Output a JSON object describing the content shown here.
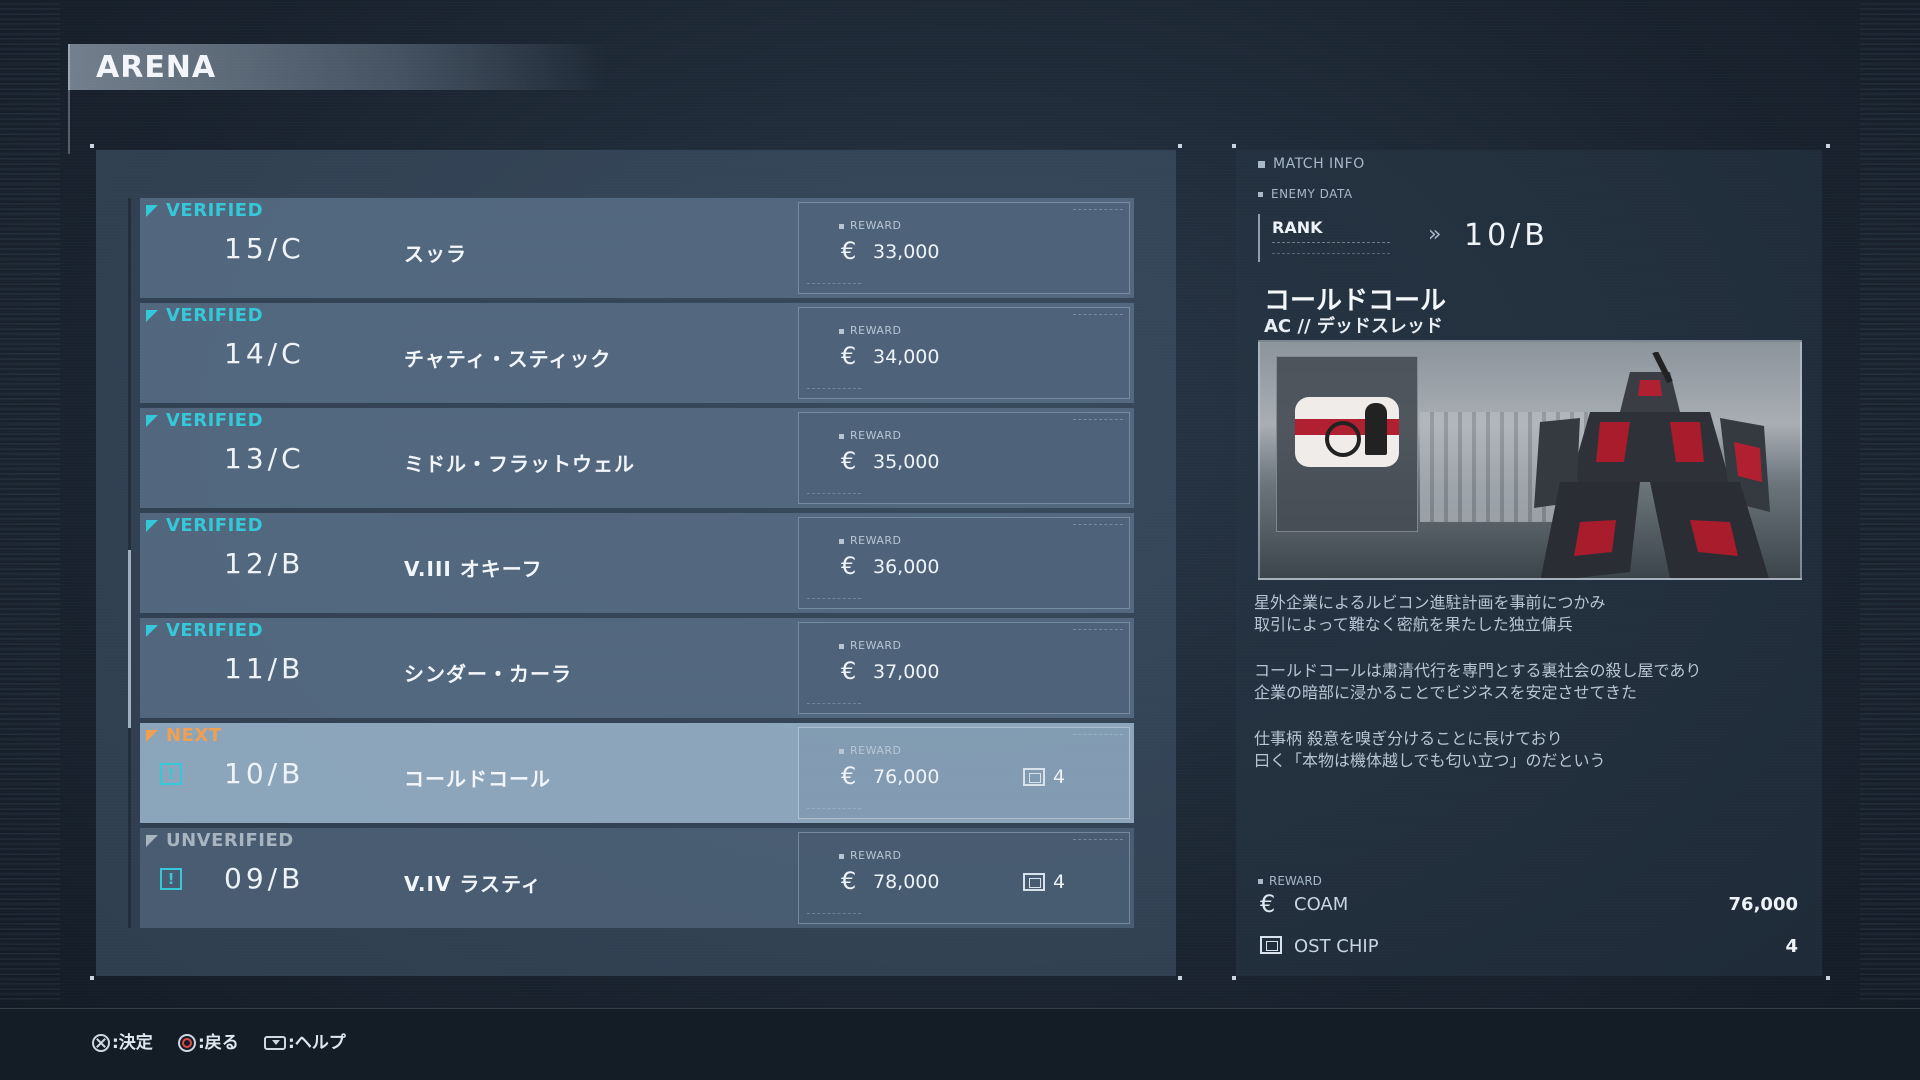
{
  "title": "ARENA",
  "matches": [
    {
      "status": "VERIFIED",
      "rank": "15/C",
      "name": "スッラ",
      "reward_label": "REWARD",
      "reward": "33,000",
      "chips": ""
    },
    {
      "status": "VERIFIED",
      "rank": "14/C",
      "name": "チャティ・スティック",
      "reward_label": "REWARD",
      "reward": "34,000",
      "chips": ""
    },
    {
      "status": "VERIFIED",
      "rank": "13/C",
      "name": "ミドル・フラットウェル",
      "reward_label": "REWARD",
      "reward": "35,000",
      "chips": ""
    },
    {
      "status": "VERIFIED",
      "rank": "12/B",
      "name": "V.III オキーフ",
      "reward_label": "REWARD",
      "reward": "36,000",
      "chips": ""
    },
    {
      "status": "VERIFIED",
      "rank": "11/B",
      "name": "シンダー・カーラ",
      "reward_label": "REWARD",
      "reward": "37,000",
      "chips": ""
    },
    {
      "status": "NEXT",
      "rank": "10/B",
      "name": "コールドコール",
      "reward_label": "REWARD",
      "reward": "76,000",
      "chips": "4"
    },
    {
      "status": "UNVERIFIED",
      "rank": "09/B",
      "name": "V.IV ラスティ",
      "reward_label": "REWARD",
      "reward": "78,000",
      "chips": "4"
    }
  ],
  "currency_symbol": "€",
  "warn_symbol": "!",
  "match_info": {
    "header": "MATCH INFO",
    "enemy_data": "ENEMY DATA",
    "rank_label": "RANK",
    "rank_arrow": "»",
    "rank_value": "10/B",
    "enemy_name": "コールドコール",
    "enemy_ac": "AC // デッドスレッド",
    "description": [
      "星外企業によるルビコン進駐計画を事前につかみ",
      "取引によって難なく密航を果たした独立傭兵",
      "コールドコールは粛清代行を専門とする裏社会の殺し屋であり",
      "企業の暗部に浸かることでビジネスを安定させてきた",
      "仕事柄 殺意を嗅ぎ分けることに長けており",
      "曰く「本物は機体越しでも匂い立つ」のだという"
    ],
    "reward_label": "REWARD",
    "coam_label": "COAM",
    "coam_value": "76,000",
    "chip_label": "OST CHIP",
    "chip_value": "4"
  },
  "footer": {
    "confirm": ":決定",
    "back": ":戻る",
    "help": ":ヘルプ"
  },
  "colors": {
    "verified": "#35c8d8",
    "next": "#f0a050",
    "unverified": "#a8b4c0"
  }
}
